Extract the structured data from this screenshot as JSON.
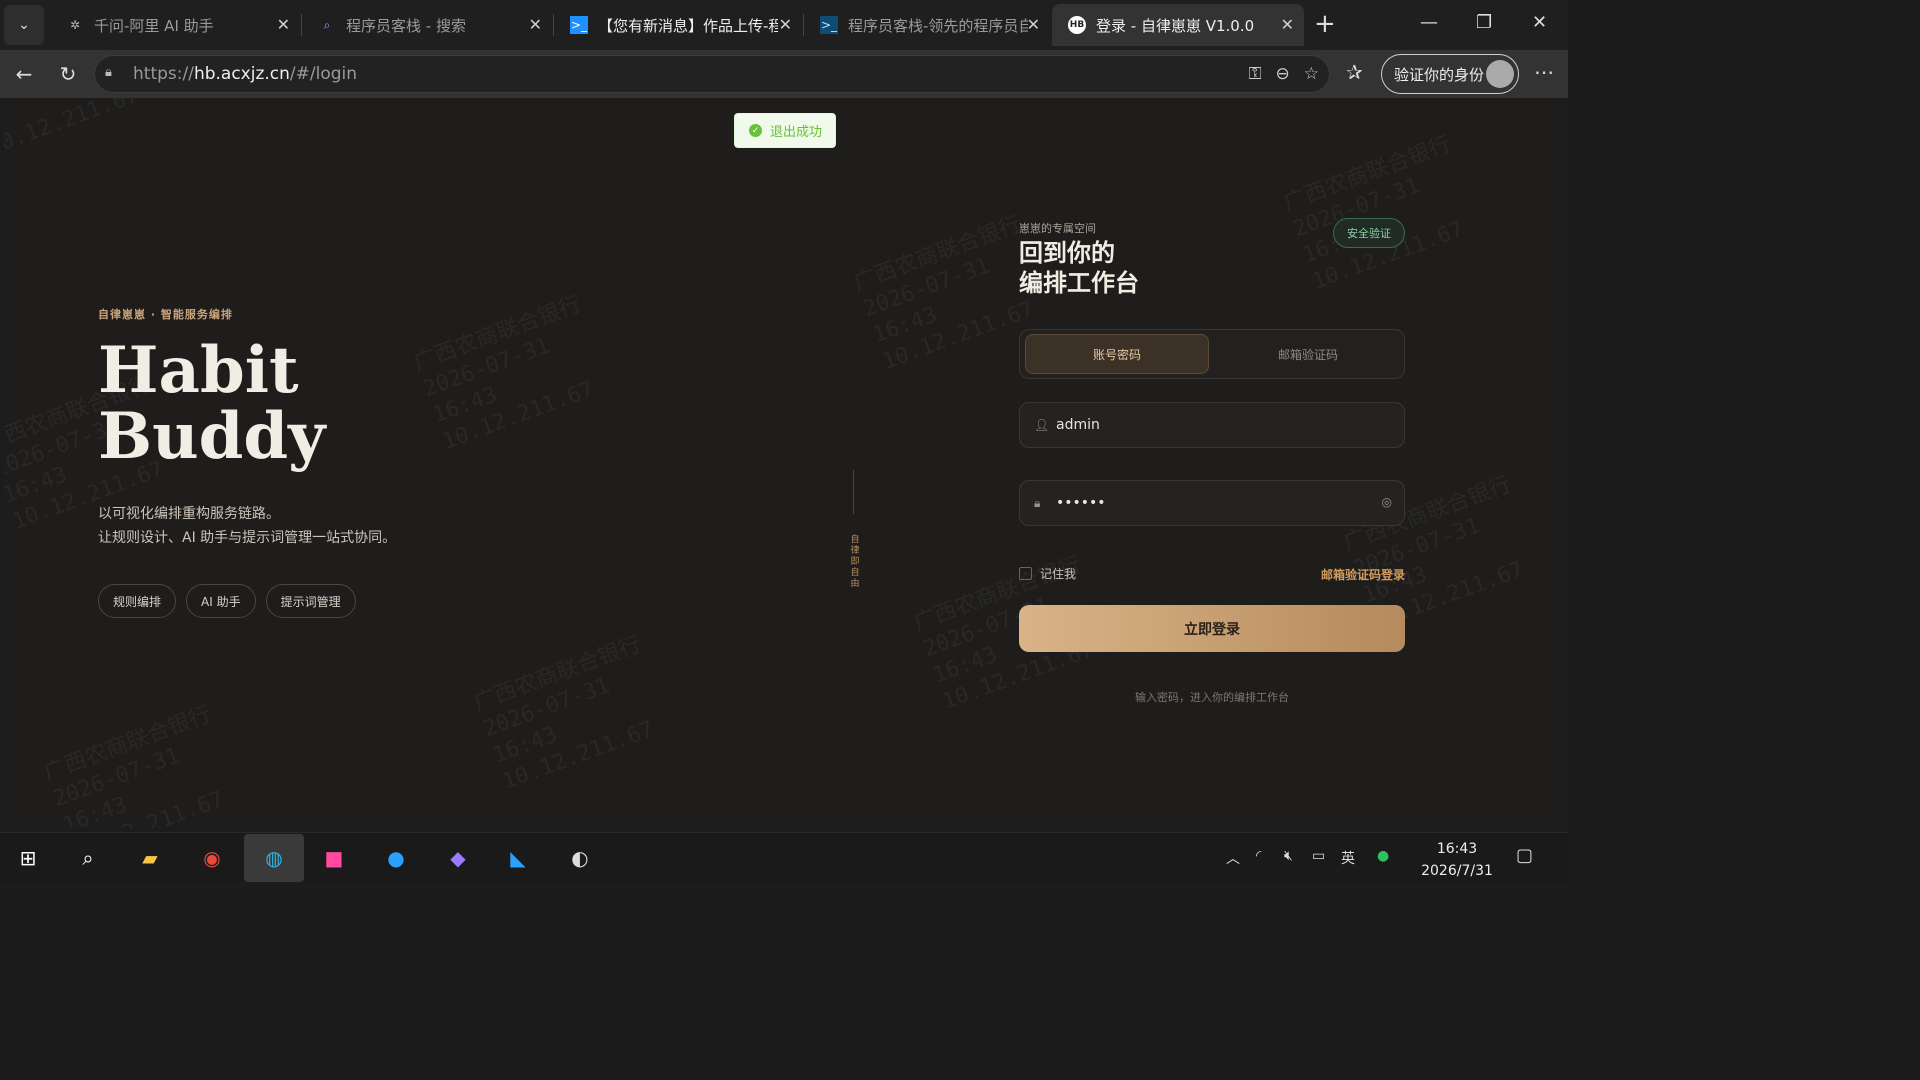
{
  "browser": {
    "tabs": [
      {
        "title": "千问-阿里 AI 助手",
        "icon": "qwen-icon"
      },
      {
        "title": "程序员客栈 - 搜索",
        "icon": "search-icon"
      },
      {
        "title": "【您有新消息】作品上传-程",
        "icon": "terminal-icon"
      },
      {
        "title": "程序员客栈-领先的程序员自",
        "icon": "terminal-icon"
      },
      {
        "title": "登录 - 自律崽崽 V1.0.0",
        "icon": "hb-logo-icon"
      }
    ],
    "address": {
      "prefix": "https://",
      "host": "hb.acxjz.cn",
      "path": "/#/login"
    },
    "profile_button": "验证你的身份"
  },
  "toast": {
    "text": "退出成功"
  },
  "hero": {
    "kicker": "自律崽崽 · 智能服务编排",
    "title_line1": "Habit",
    "title_line2": "Buddy",
    "desc_line1": "以可视化编排重构服务链路。",
    "desc_line2": "让规则设计、AI 助手与提示词管理一站式协同。",
    "chips": [
      "规则编排",
      "AI 助手",
      "提示词管理"
    ],
    "vertical_text": "自律即自由"
  },
  "login": {
    "kicker": "崽崽的专属空间",
    "title_line1": "回到你的",
    "title_line2": "编排工作台",
    "badge": "安全验证",
    "tabs": [
      "账号密码",
      "邮箱验证码"
    ],
    "username": "admin",
    "password": "••••••",
    "remember": "记住我",
    "email_link": "邮箱验证码登录",
    "submit": "立即登录",
    "hint": "输入密码，进入你的编排工作台"
  },
  "watermark": {
    "line1": "广西农商联合银行",
    "line2": "2026-07-31",
    "line3": "16:43",
    "line4": "10.12.211.67"
  },
  "taskbar": {
    "ime": "英",
    "time": "16:43",
    "date": "2026/7/31"
  },
  "colors": {
    "accent": "#c9a27a",
    "button": "#d9b488",
    "success": "#67c23a"
  }
}
